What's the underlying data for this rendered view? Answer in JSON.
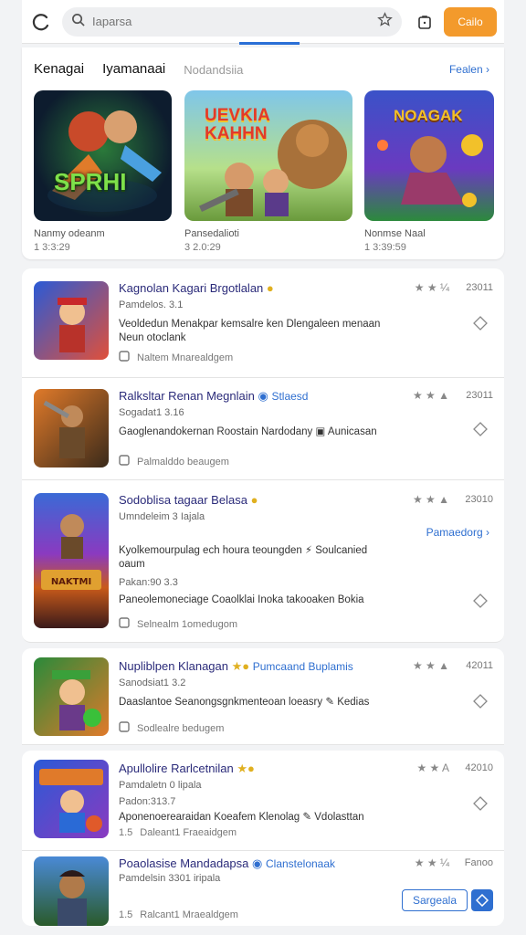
{
  "topbar": {
    "search_placeholder": "Iaparsa",
    "cta_label": "Cailo"
  },
  "featured": {
    "tabs": [
      "Kenagai",
      "Iyamanaai",
      "Nodandsiia"
    ],
    "more_label": "Fealen",
    "cards": [
      {
        "art_text": "SPRHI",
        "caption": "Nanmy odeanm",
        "sub": "1 3:3:29"
      },
      {
        "art_text": "UEVKIA KAHHN",
        "caption": "Pansedalioti",
        "sub": "3 2.0:29"
      },
      {
        "art_text": "NOAGAK",
        "caption": "Nonmse Naal",
        "sub": "1 3:39:59"
      }
    ]
  },
  "list": {
    "items": [
      {
        "title": "Kagnolan Kagari Brgotlalan",
        "meta": "Pamdelos. 3.1",
        "desc": "Veoldedun Menakpar kemsalre ken Dlengaleen menaan Neun otoclank",
        "foot": "Naltem Mnarealdgem",
        "stars": "★ ★ ¼",
        "score": "23011"
      },
      {
        "title": "Ralksltar Renan Megnlain",
        "tag": "Stlaesd",
        "meta": "Sogadat1 3.16",
        "desc": "Gaoglenandokernan Roostain Nardodany",
        "desc_tag": "Aunicasan",
        "foot": "Palmalddo beaugem",
        "stars": "★ ★ ▲",
        "score": "23011"
      },
      {
        "title": "Sodoblisa tagaar Belasa",
        "meta": "Umndeleim 3 Iajala",
        "more": "Pamaedorg",
        "desc": "Kyolkemourpulag ech houra teoungden",
        "desc_tag": "Soulcanied",
        "desc2": "oaum",
        "meta2": "Pakan:90 3.3",
        "desc3": "Paneolemoneciage Coaolklai Inoka takooaken Bokia",
        "foot": "Selnealm 1omedugom",
        "stars": "★ ★ ▲",
        "score": "23010"
      },
      {
        "title": "Nupliblpen Klanagan",
        "tag": "Pumcaand Buplamis",
        "meta": "Sanodsiat1 3.2",
        "desc": "Daaslantoe Seanongsgnkmenteoan loeasry",
        "desc_tag": "Kedias",
        "foot": "Sodlealre bedugem",
        "stars": "★ ★ ▲",
        "score": "42011"
      },
      {
        "title": "Apullolire Rarlcetnilan",
        "meta": "Pamdaletn 0 lipala",
        "meta2": "Padon:313.7",
        "desc": "Aponenoerearaidan Koeafem Klenolag",
        "desc_tag": "Vdolasttan",
        "foot": "Daleant1 Fraeaidgem",
        "foot_prefix": "1.5",
        "stars": "★ ★ A",
        "score": "42010"
      },
      {
        "title": "Poaolasise Mandadapsa",
        "tag": "Clanstelonaak",
        "meta": "Pamdelsin 3301 iripala",
        "foot": "Ralcant1 Mraealdgem",
        "foot_prefix": "1.5",
        "stars": "★ ★ ¼",
        "score": "Fanoo",
        "button": "Sargeala"
      }
    ]
  },
  "colors": {
    "accent": "#2f6fd0",
    "cta": "#f39a2c"
  }
}
